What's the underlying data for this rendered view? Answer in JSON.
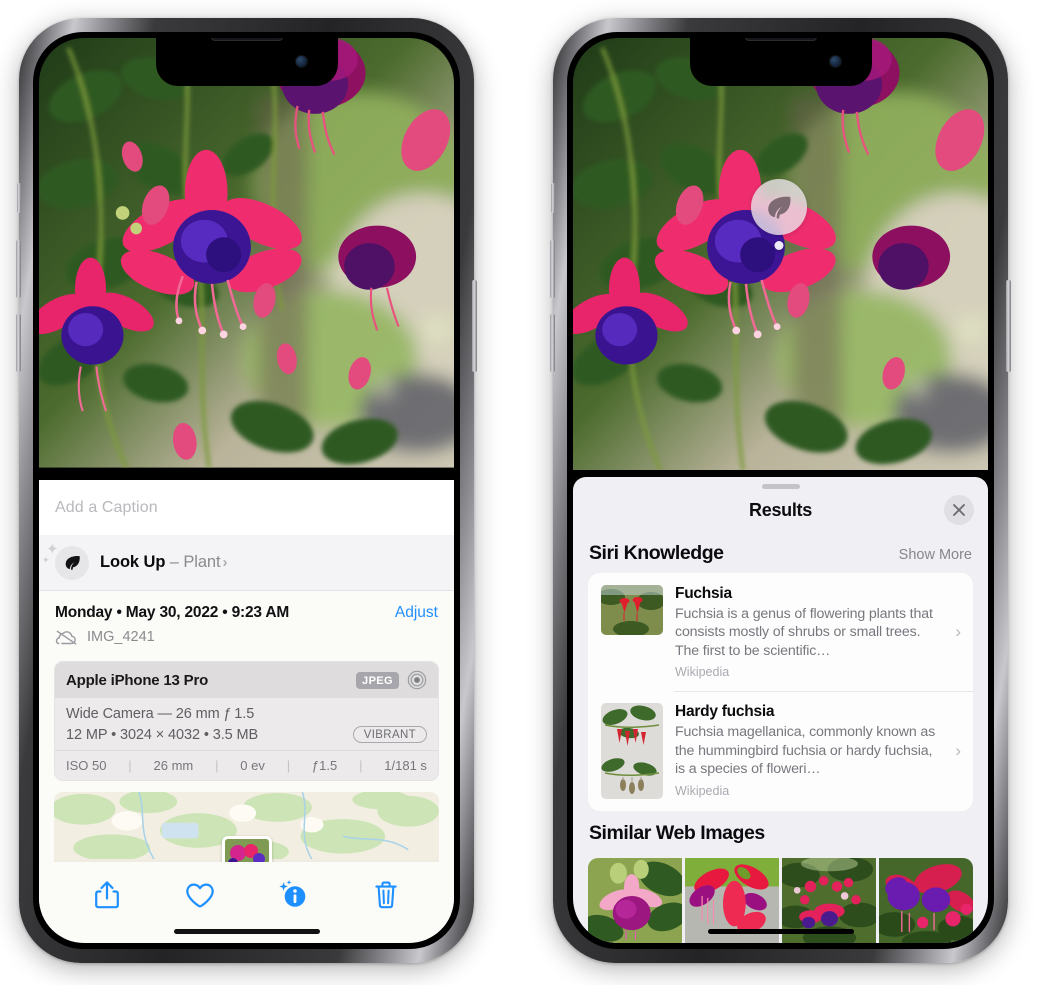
{
  "left_phone": {
    "name": "photos-detail-view",
    "caption": {
      "placeholder": "Add a Caption",
      "value": ""
    },
    "lookup": {
      "label_bold": "Look Up",
      "dash": " – ",
      "label_light": "Plant",
      "chevron": "›",
      "icon": "leaf-icon"
    },
    "meta": {
      "date": "Monday • May 30, 2022 • 9:23 AM",
      "adjust_label": "Adjust",
      "filename": "IMG_4241",
      "cloud_icon": "cloud-slash-icon"
    },
    "camera_card": {
      "device": "Apple iPhone 13 Pro",
      "format_badge": "JPEG",
      "lens_icon": "lens-circle-icon",
      "lens_line": "Wide Camera — 26 mm ƒ 1.5",
      "size_line": "12 MP • 3024 × 4032 • 3.5 MB",
      "profile_badge": "VIBRANT",
      "exif": [
        "ISO 50",
        "26 mm",
        "0 ev",
        "ƒ1.5",
        "1/181 s"
      ]
    },
    "toolbar": [
      {
        "name": "share-button",
        "icon": "share-icon"
      },
      {
        "name": "favorite-button",
        "icon": "heart-icon"
      },
      {
        "name": "info-button",
        "icon": "info-sparkle-icon"
      },
      {
        "name": "delete-button",
        "icon": "trash-icon"
      }
    ]
  },
  "right_phone": {
    "name": "visual-lookup-results",
    "bubble": {
      "icon": "leaf-icon"
    },
    "sheet": {
      "title": "Results",
      "close_icon": "close-icon",
      "sections": [
        {
          "title": "Siri Knowledge",
          "action": "Show More",
          "items": [
            {
              "title": "Fuchsia",
              "description": "Fuchsia is a genus of flowering plants that consists mostly of shrubs or small trees. The first to be scientific…",
              "source": "Wikipedia",
              "chevron": "›"
            },
            {
              "title": "Hardy fuchsia",
              "description": "Fuchsia magellanica, commonly known as the hummingbird fuchsia or hardy fuchsia, is a species of floweri…",
              "source": "Wikipedia",
              "chevron": "›"
            }
          ]
        },
        {
          "title": "Similar Web Images",
          "action": "",
          "thumbnails": [
            "web-image-1",
            "web-image-2",
            "web-image-3",
            "web-image-4"
          ]
        }
      ]
    }
  },
  "colors": {
    "accent_blue": "#1e8fff",
    "sheet_bg": "#f0eff4",
    "info_bg": "#fbfbf8",
    "card_bg": "#fdfdfe",
    "muted_text": "#8b8b90",
    "badge_gray": "#a6a6ac"
  }
}
